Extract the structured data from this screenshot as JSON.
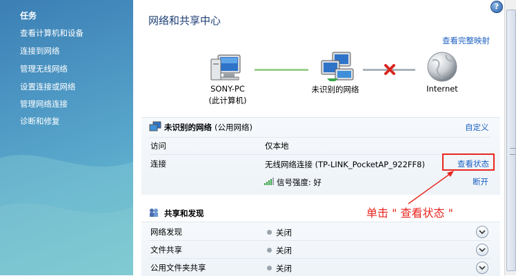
{
  "sidebar": {
    "heading": "任务",
    "items": [
      {
        "label": "查看计算机和设备"
      },
      {
        "label": "连接到网络"
      },
      {
        "label": "管理无线网络"
      },
      {
        "label": "设置连接或网络"
      },
      {
        "label": "管理网络连接"
      },
      {
        "label": "诊断和修复"
      }
    ]
  },
  "header": {
    "title": "网络和共享中心",
    "help": "?"
  },
  "network_map": {
    "view_full_map": "查看完整映射",
    "computer": {
      "name": "SONY-PC",
      "subtitle": "(此计算机)"
    },
    "network": {
      "name": "未识别的网络"
    },
    "internet": {
      "name": "Internet"
    }
  },
  "network_panel": {
    "name": "未识别的网络",
    "type": "(公用网络)",
    "customize": "自定义",
    "rows": [
      {
        "label": "访问",
        "value": "仅本地"
      },
      {
        "label": "连接",
        "value": "无线网络连接 (TP-LINK_PocketAP_922FF8)",
        "action": "查看状态"
      },
      {
        "label": "",
        "value": "信号强度: 好",
        "action": "断开"
      }
    ]
  },
  "annotation": "单击 \" 查看状态 \"",
  "sharing": {
    "heading": "共享和发现",
    "rows": [
      {
        "label": "网络发现",
        "value": "关闭"
      },
      {
        "label": "文件共享",
        "value": "关闭"
      },
      {
        "label": "公用文件夹共享",
        "value": "关闭"
      }
    ]
  },
  "colors": {
    "accent": "#1c60c2",
    "title": "#1e3f74",
    "annotation": "#e8251f",
    "sidebar": "#4d97c4"
  }
}
